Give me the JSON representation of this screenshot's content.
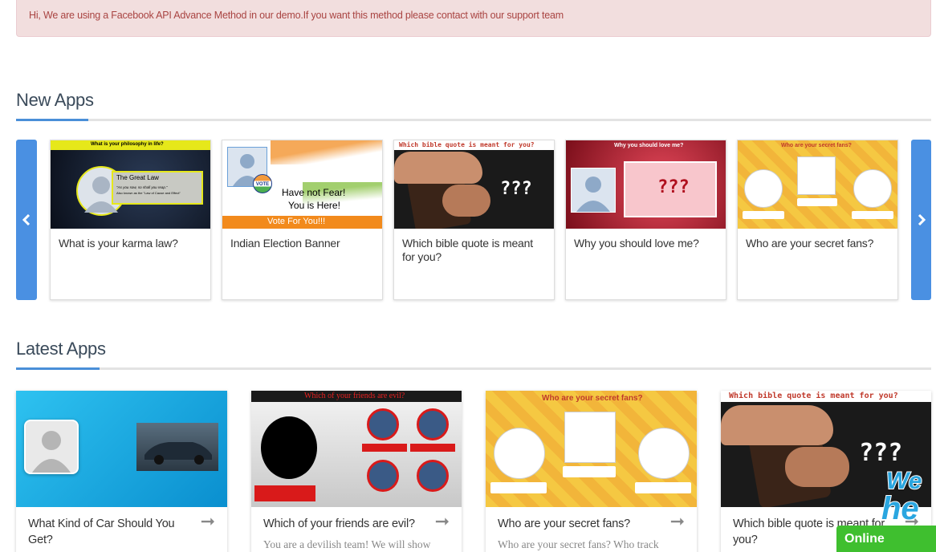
{
  "alert": {
    "text": "Hi, We are using a Facebook API Advance Method in our demo.If you want this method please contact with our support team"
  },
  "new_apps": {
    "title": "New Apps",
    "prev_icon": "chevron-left-icon",
    "next_icon": "chevron-right-icon",
    "cards": [
      {
        "title": "What is your karma law?",
        "thumb_heading": "What is your philosophy in life?",
        "thumb_box_title": "The Great Law",
        "thumb_box_text": "\"As you sow, so shall you reap.\"",
        "thumb_box_text2": "Also known as the \"Law of Cause and Effect\""
      },
      {
        "title": "Indian Election Banner",
        "thumb_line1": "Have not Fear!",
        "thumb_line2": "You is Here!",
        "thumb_footer": "Vote For You!!!",
        "thumb_badge": "VOTE"
      },
      {
        "title": "Which bible quote is meant for you?",
        "thumb_heading": "Which bible quote is meant for you?",
        "thumb_marks": "???"
      },
      {
        "title": "Why you should love me?",
        "thumb_heading": "Why you should love me?",
        "thumb_marks": "???"
      },
      {
        "title": "Who are your secret fans?",
        "thumb_heading": "Who are your secret fans?"
      }
    ]
  },
  "latest_apps": {
    "title": "Latest Apps",
    "cards": [
      {
        "title": "What Kind of Car Should You Get?",
        "desc": ""
      },
      {
        "title": "Which of your friends are evil?",
        "desc": "You are a devilish team! We will show",
        "thumb_heading": "Which of your friends are evil?"
      },
      {
        "title": "Who are your secret fans?",
        "desc": "Who are your secret fans? Who track",
        "thumb_heading": "Who are your secret fans?"
      },
      {
        "title": "Which bible quote is meant for you?",
        "desc": "",
        "thumb_heading": "Which bible quote is meant for you?",
        "thumb_marks": "???"
      }
    ]
  },
  "chat": {
    "logo_text": "We he",
    "status": "Online"
  },
  "colors": {
    "accent": "#4a90e2",
    "alert_bg": "#f2dede",
    "alert_text": "#a94442",
    "online": "#3fbf2f"
  }
}
